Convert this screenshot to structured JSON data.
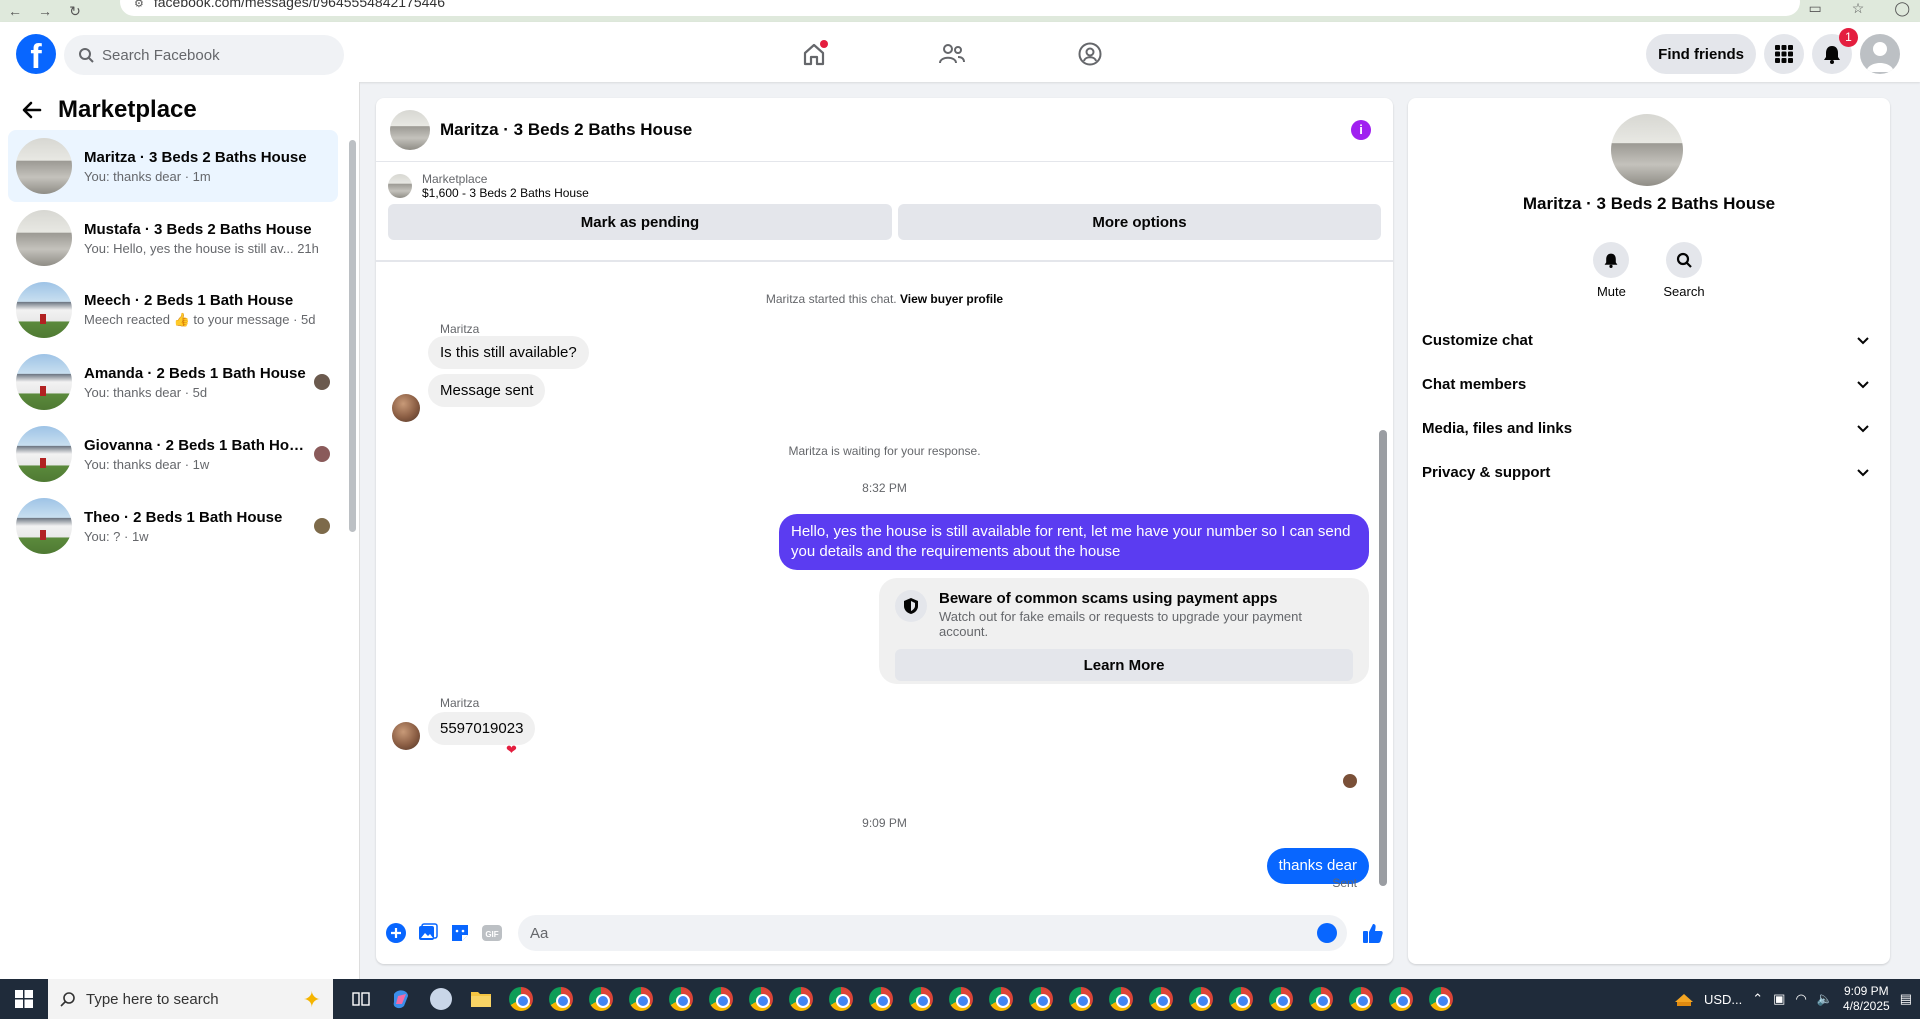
{
  "browser": {
    "url": "facebook.com/messages/t/9645554842175446"
  },
  "header": {
    "search_placeholder": "Search Facebook",
    "find_friends": "Find friends",
    "notifications_count": "1"
  },
  "sidebar": {
    "title": "Marketplace",
    "conversations": [
      {
        "name": "Maritza · 3 Beds 2 Baths House",
        "preview": "You: thanks dear · 1m",
        "thumb": "interior",
        "active": true
      },
      {
        "name": "Mustafa · 3 Beds 2 Baths House",
        "preview": "You: Hello, yes the house is still av...",
        "time": "21h",
        "thumb": "interior"
      },
      {
        "name": "Meech · 2 Beds 1 Bath House",
        "preview": "Meech reacted 👍 to your message · 5d",
        "thumb": "exterior"
      },
      {
        "name": "Amanda · 2 Beds 1 Bath House",
        "preview": "You: thanks dear · 5d",
        "thumb": "exterior"
      },
      {
        "name": "Giovanna · 2 Beds 1 Bath House",
        "preview": "You: thanks dear · 1w",
        "thumb": "exterior"
      },
      {
        "name": "Theo · 2 Beds 1 Bath House",
        "preview": "You: ? · 1w",
        "thumb": "exterior"
      }
    ]
  },
  "chat": {
    "title": "Maritza · 3 Beds 2 Baths House",
    "listing_category": "Marketplace",
    "listing_detail": "$1,600 - 3 Beds 2 Baths House",
    "mark_pending": "Mark as pending",
    "more_options": "More options",
    "started_text": "Maritza started this chat.",
    "view_profile": "View buyer profile",
    "sender_name": "Maritza",
    "msg1": "Is this still available?",
    "msg2": "Message sent",
    "waiting_text": "Maritza is waiting for your response.",
    "time1": "8:32 PM",
    "out1": "Hello, yes the house is still available for rent, let me have your number so I can send you details and the requirements about the house",
    "scam_title": "Beware of common scams using payment apps",
    "scam_sub": "Watch out for fake emails or requests to upgrade your payment account.",
    "learn_more": "Learn More",
    "msg3": "5597019023",
    "time2": "9:09 PM",
    "out2": "thanks dear",
    "sent_label": "Sent",
    "composer_placeholder": "Aa"
  },
  "details": {
    "title": "Maritza · 3 Beds 2 Baths House",
    "mute": "Mute",
    "search": "Search",
    "sections": [
      "Customize chat",
      "Chat members",
      "Media, files and links",
      "Privacy & support"
    ]
  },
  "taskbar": {
    "search_placeholder": "Type here to search",
    "currency": "USD...",
    "time": "9:09 PM",
    "date": "4/8/2025"
  }
}
